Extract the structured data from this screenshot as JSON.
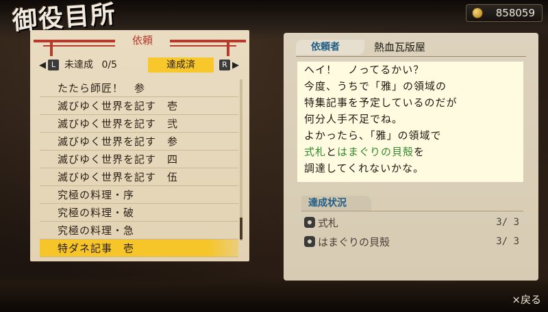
{
  "screen": {
    "title": "御役目所",
    "money": "858059"
  },
  "left_panel": {
    "label": "依頼",
    "tabs": {
      "left_key": "L",
      "right_key": "R",
      "left_arrow": "◀",
      "right_arrow": "▶",
      "incomplete_label": "未達成",
      "incomplete_count": "0/5",
      "complete_label": "達成済"
    },
    "items": [
      {
        "label": "たたら師匠！　参"
      },
      {
        "label": "滅びゆく世界を記す　壱"
      },
      {
        "label": "滅びゆく世界を記す　弐"
      },
      {
        "label": "滅びゆく世界を記す　参"
      },
      {
        "label": "滅びゆく世界を記す　四"
      },
      {
        "label": "滅びゆく世界を記す　伍"
      },
      {
        "label": "究極の料理・序"
      },
      {
        "label": "究極の料理・破"
      },
      {
        "label": "究極の料理・急"
      },
      {
        "label": "特ダネ記事　壱"
      }
    ],
    "selected_index": 9
  },
  "right_panel": {
    "requester_label": "依頼者",
    "requester_name": "熱血瓦版屋",
    "message": {
      "l1": "ヘイ！　ノってるかい？",
      "l2": "今度、うちで「雅」の領域の",
      "l3": "特集記事を予定しているのだが",
      "l4": "何分人手不足でね。",
      "l5": "よかったら、「雅」の領域で",
      "l6_item1": "式札",
      "l6_and": "と",
      "l6_item2": "はまぐりの貝殻",
      "l6_end": "を",
      "l7": "調達してくれないかな。"
    },
    "status_label": "達成状況",
    "status_items": [
      {
        "name": "式札",
        "count": "3/ 3"
      },
      {
        "name": "はまぐりの貝殻",
        "count": "3/ 3"
      }
    ]
  },
  "footer": {
    "back_label": "×戻る"
  },
  "colors": {
    "accent_yellow": "#f7c72b",
    "torii_red": "#b6392a",
    "label_blue": "#1f5d86",
    "highlight_green": "#2f8a2a"
  }
}
